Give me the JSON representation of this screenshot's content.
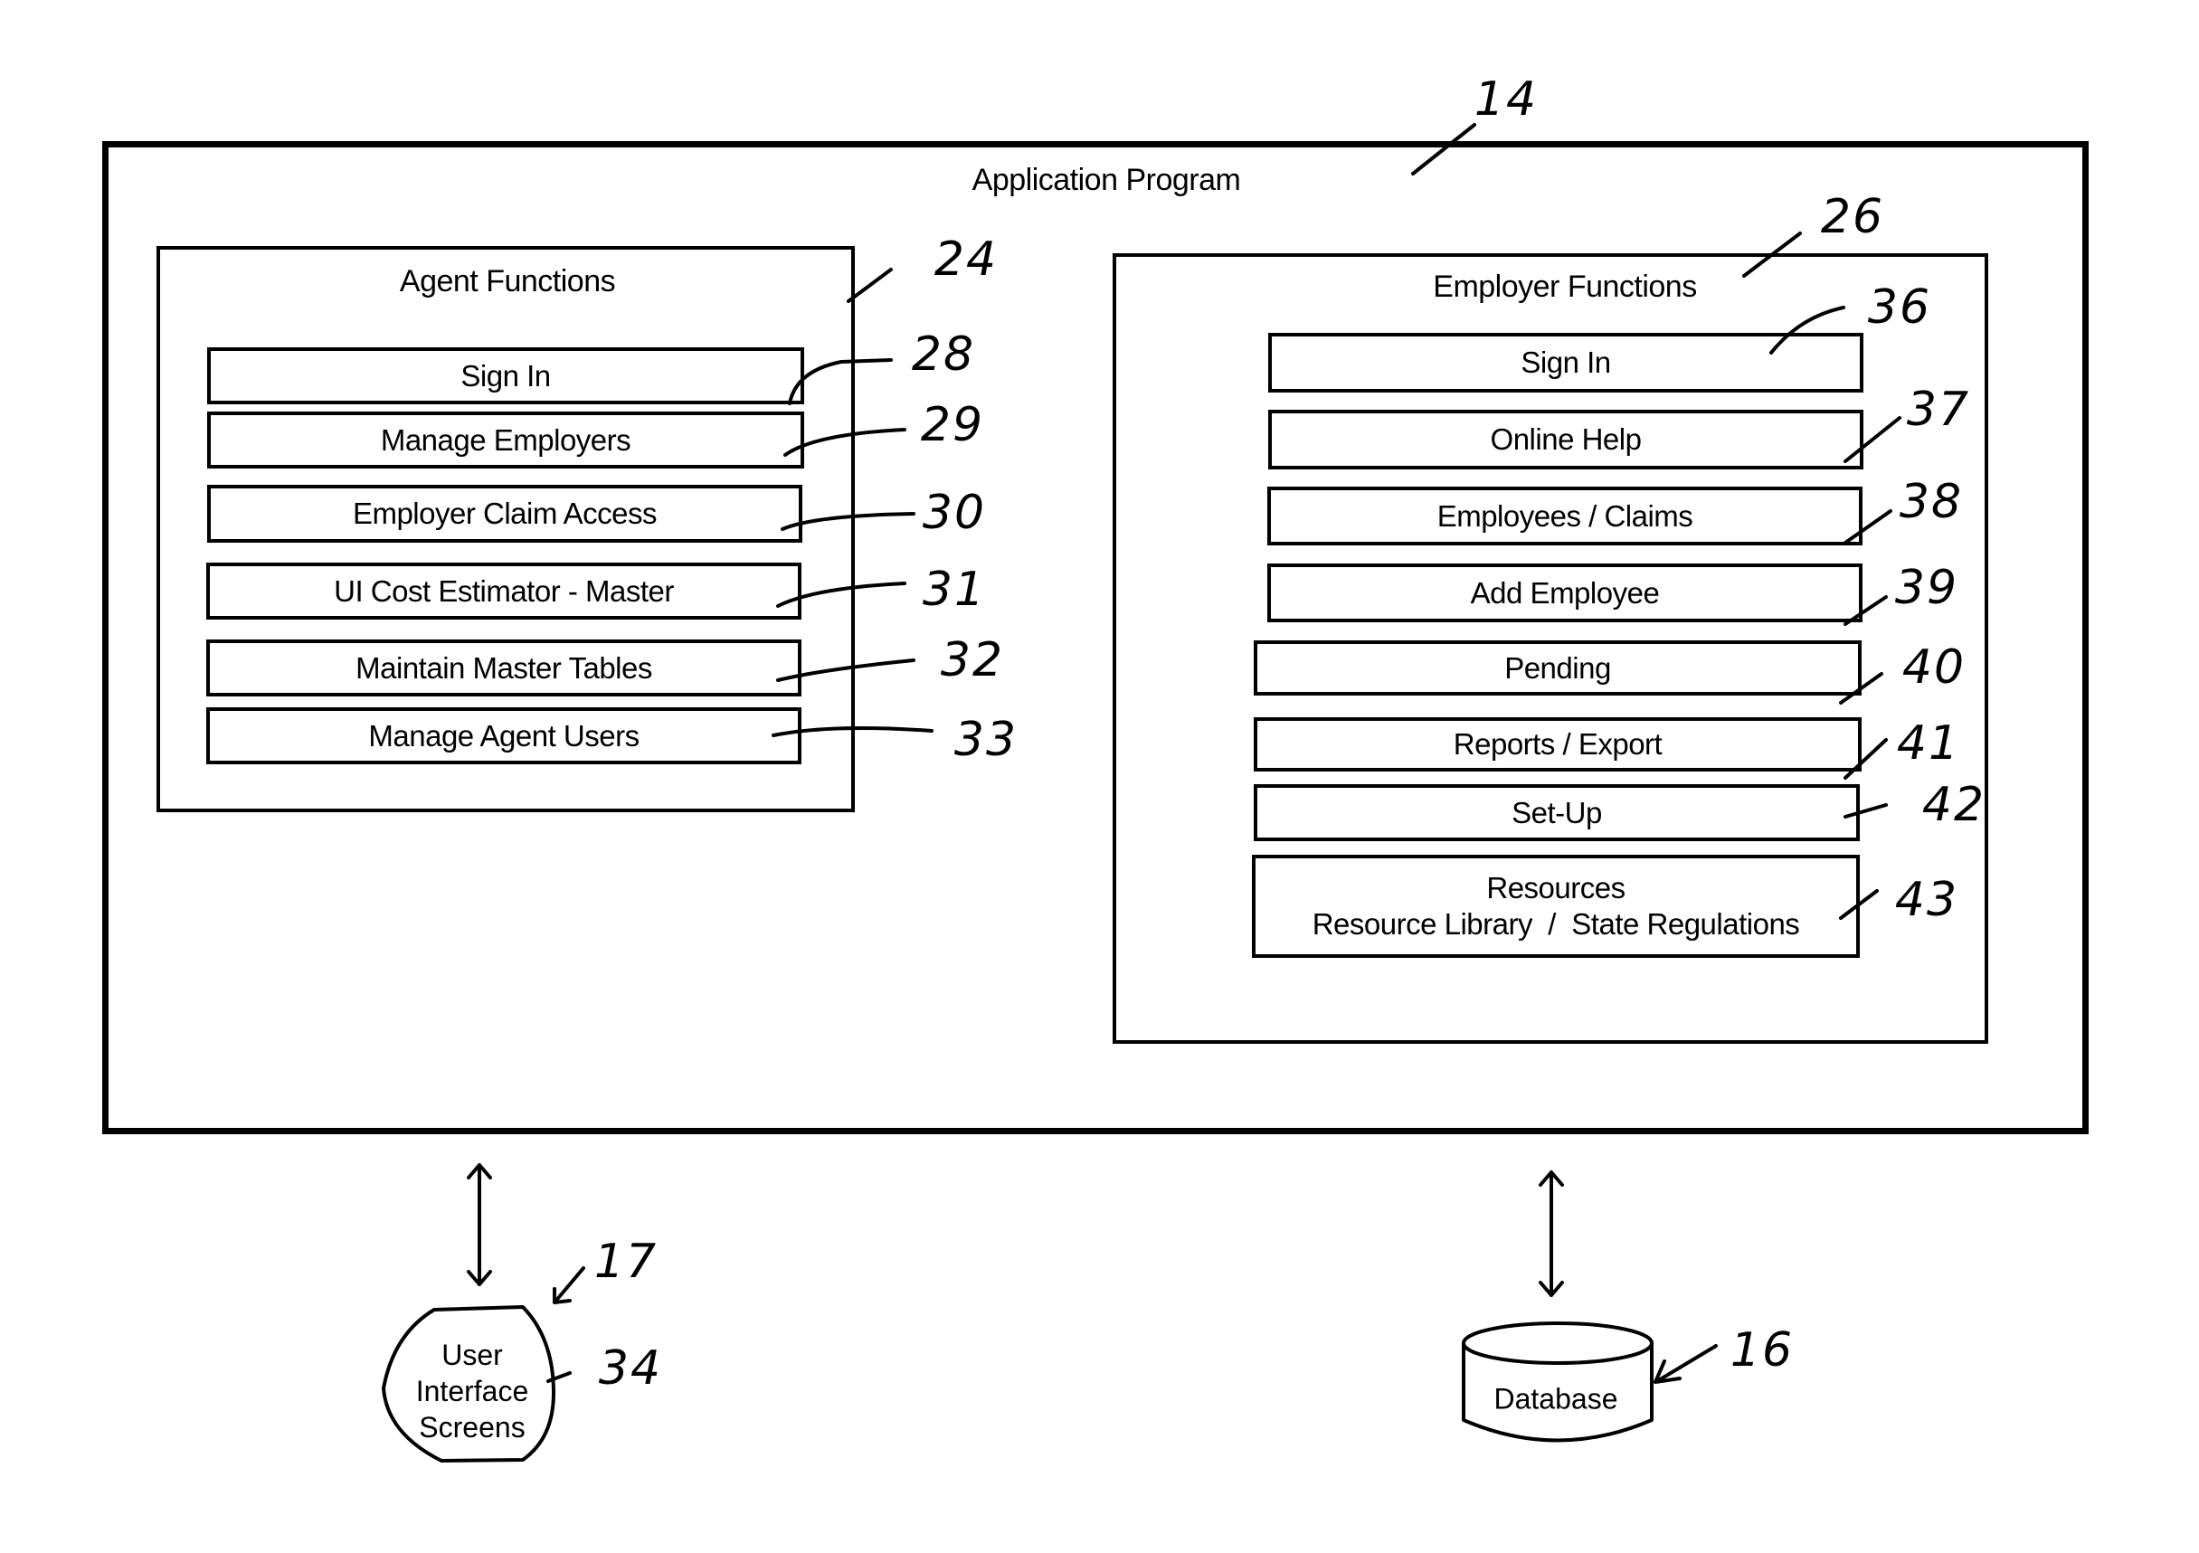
{
  "application": {
    "title": "Application Program",
    "ref": "14"
  },
  "agent_functions": {
    "title": "Agent Functions",
    "ref": "24",
    "items": [
      {
        "label": "Sign In",
        "ref": "28"
      },
      {
        "label": "Manage Employers",
        "ref": "29"
      },
      {
        "label": "Employer Claim Access",
        "ref": "30"
      },
      {
        "label": "UI Cost Estimator - Master",
        "ref": "31"
      },
      {
        "label": "Maintain Master Tables",
        "ref": "32"
      },
      {
        "label": "Manage Agent Users",
        "ref": "33"
      }
    ]
  },
  "employer_functions": {
    "title": "Employer Functions",
    "ref": "26",
    "items": [
      {
        "label": "Sign In",
        "ref": "36"
      },
      {
        "label": "Online Help",
        "ref": "37"
      },
      {
        "label": "Employees / Claims",
        "ref": "38"
      },
      {
        "label": "Add Employee",
        "ref": "39"
      },
      {
        "label": "Pending",
        "ref": "40"
      },
      {
        "label": "Reports / Export",
        "ref": "41"
      },
      {
        "label": "Set-Up",
        "ref": "42"
      },
      {
        "label": "Resources",
        "sublabel": "Resource Library  /  State Regulations",
        "ref": "43"
      }
    ]
  },
  "user_interface": {
    "lines": [
      "User",
      "Interface",
      "Screens"
    ],
    "ref_group": "17",
    "ref": "34"
  },
  "database": {
    "label": "Database",
    "ref": "16"
  }
}
